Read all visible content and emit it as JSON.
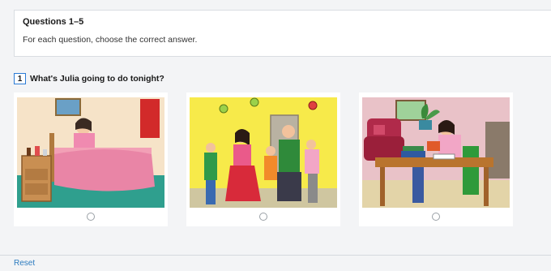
{
  "instructions": {
    "title": "Questions 1–5",
    "text": "For each question, choose the correct answer."
  },
  "question": {
    "number": "1",
    "text": "What's Julia going to do tonight?"
  },
  "options": [
    {
      "scene": "sleeping-in-bed"
    },
    {
      "scene": "dancing-at-party"
    },
    {
      "scene": "reading-at-table"
    }
  ],
  "footer": {
    "reset_label": "Reset"
  }
}
